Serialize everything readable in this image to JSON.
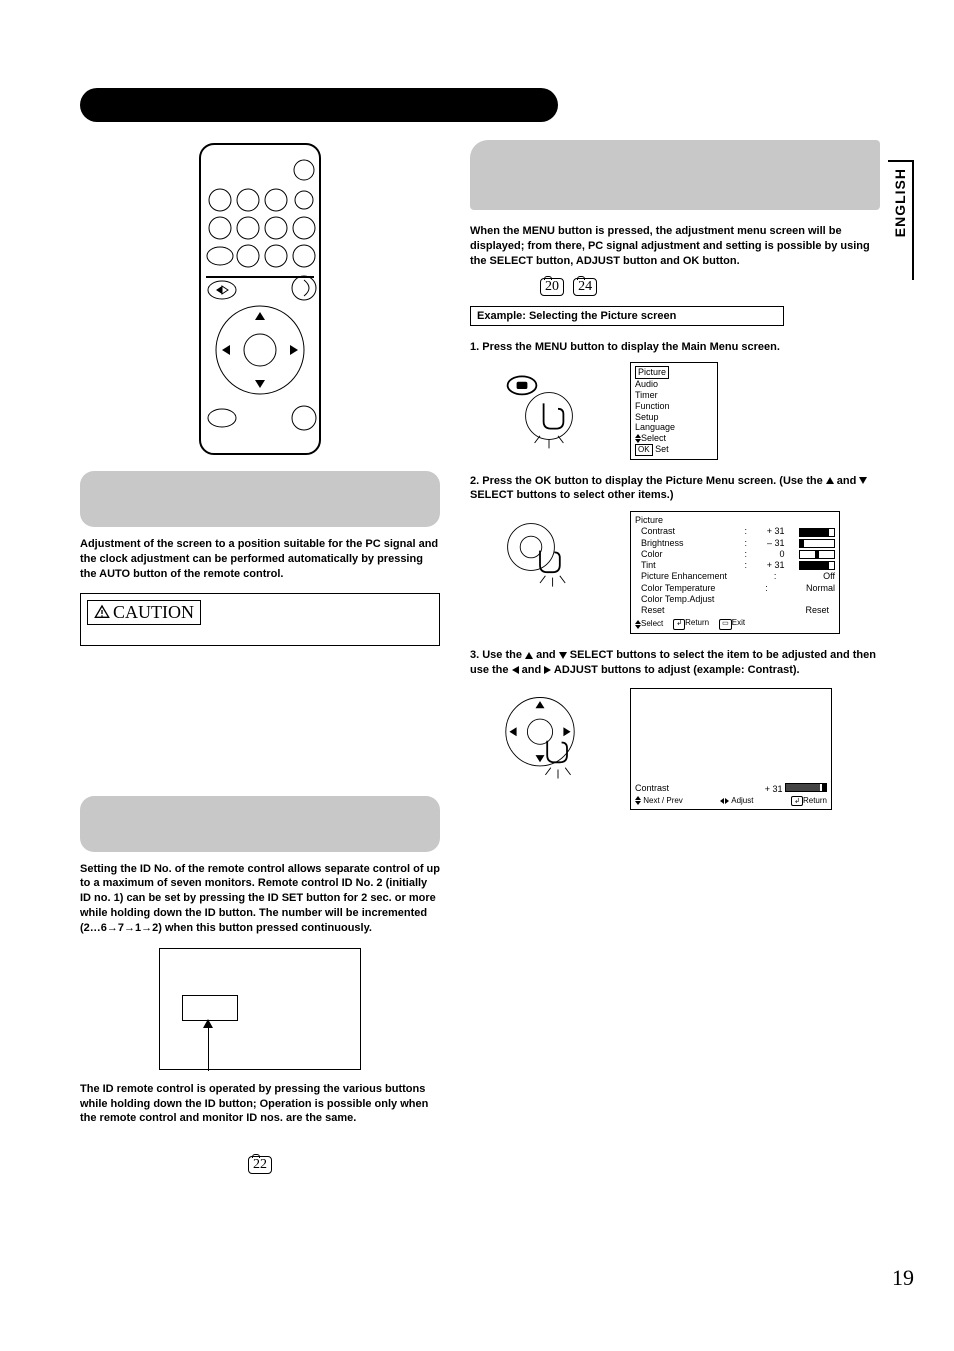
{
  "lang_tab": "ENGLISH",
  "page_number": "19",
  "bottom_page_ref": "22",
  "left": {
    "auto_adjust_text": "Adjustment of the screen to a position suitable for the PC signal and the clock adjustment can be performed automatically by pressing the AUTO button of the remote control.",
    "caution_label": "CAUTION",
    "id_set_intro": "Setting the ID No. of the remote control allows separate control of up to a maximum of seven monitors. Remote control ID No. 2 (initially ID no. 1) can be set by pressing the ID SET button for 2 sec. or more while holding down the ID button.  The number will be incremented (2…6→7→1→2) when this button pressed continuously.",
    "id_operate_text": "The ID remote control is operated by pressing the various buttons while holding down the ID button; Operation is possible only when the remote control and monitor ID nos. are the same."
  },
  "right": {
    "intro": "When the MENU button is pressed, the adjustment menu screen will be displayed; from there, PC signal adjustment and setting is possible by using the SELECT button, ADJUST button and OK button.",
    "ref1": "20",
    "ref2": "24",
    "example_label": "Example: Selecting the Picture screen",
    "step1": "1. Press the MENU button to display the Main Menu screen.",
    "main_menu": {
      "items": [
        "Picture",
        "Audio",
        "Timer",
        "Function",
        "Setup",
        "Language"
      ],
      "select": "Select",
      "set": "Set",
      "ok": "OK"
    },
    "step2a": "2. Press the OK button to display the Picture Menu screen. (Use the ",
    "step2b": " and ",
    "step2c": " SELECT buttons to select other items.)",
    "picture_menu": {
      "title": "Picture",
      "rows": [
        {
          "label": "Contrast",
          "value": "+ 31",
          "fillLeft": "0",
          "fillWidth": "85"
        },
        {
          "label": "Brightness",
          "value": "– 31",
          "fillLeft": "0",
          "fillWidth": "10"
        },
        {
          "label": "Color",
          "value": "0",
          "fillLeft": "45",
          "fillWidth": "10"
        },
        {
          "label": "Tint",
          "value": "+ 31",
          "fillLeft": "0",
          "fillWidth": "85"
        }
      ],
      "plain": [
        {
          "label": "Picture Enhancement",
          "value": "Off"
        },
        {
          "label": "Color Temperature",
          "value": "Normal"
        },
        {
          "label": "Color Temp.Adjust",
          "value": ""
        }
      ],
      "reset_label": "Reset",
      "reset_btn": "Reset",
      "nav_select": "Select",
      "nav_return": "Return",
      "nav_exit": "Exit"
    },
    "step3a": "3. Use the ",
    "step3b": " and ",
    "step3c": " SELECT buttons to select the item to be adjusted and then use the ",
    "step3d": " and ",
    "step3e": " ADJUST buttons to adjust (example: Contrast).",
    "contrast_detail": {
      "label": "Contrast",
      "value": "+ 31",
      "next": "Next / Prev",
      "adjust": "Adjust",
      "ret": "Return"
    }
  }
}
